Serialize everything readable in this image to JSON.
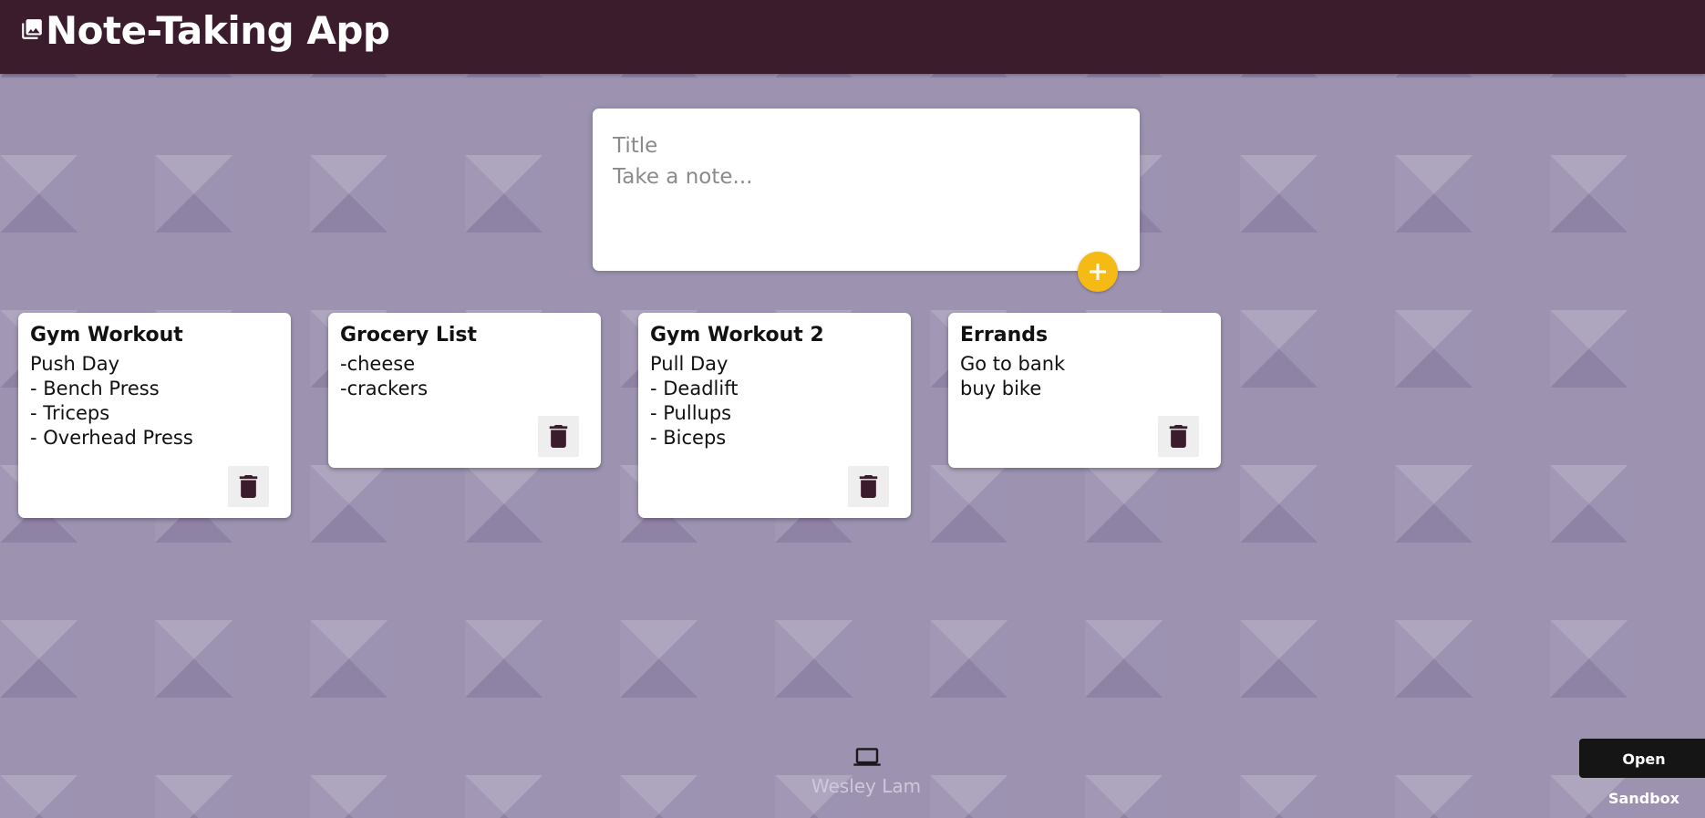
{
  "header": {
    "title": "Note-Taking App"
  },
  "composer": {
    "title_placeholder": "Title",
    "content_placeholder": "Take a note...",
    "add_button_icon": "plus-icon"
  },
  "notes": [
    {
      "title": "Gym Workout",
      "content": "Push Day\n- Bench Press\n- Triceps\n- Overhead Press"
    },
    {
      "title": "Grocery List",
      "content": "-cheese\n-crackers"
    },
    {
      "title": "Gym Workout 2",
      "content": "Pull Day\n- Deadlift\n- Pullups\n- Biceps"
    },
    {
      "title": "Errands",
      "content": "Go to bank\nbuy bike"
    }
  ],
  "footer": {
    "author": "Wesley Lam",
    "icon": "laptop-icon"
  },
  "sandbox": {
    "label": "Open Sandbox"
  },
  "colors": {
    "header": "#3a1c2c",
    "accent": "#f5ba13",
    "background": "#9d93b1"
  }
}
